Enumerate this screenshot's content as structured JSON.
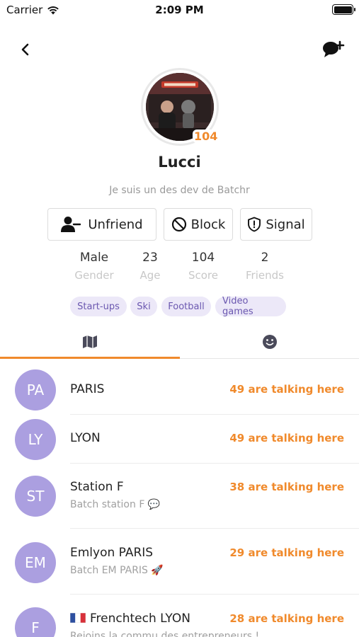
{
  "status_bar": {
    "carrier": "Carrier",
    "time": "2:09 PM"
  },
  "profile": {
    "name": "Lucci",
    "bio": "Je suis un des dev de Batchr",
    "score_badge": "104"
  },
  "actions": {
    "unfriend": "Unfriend",
    "block": "Block",
    "signal": "Signal"
  },
  "stats": [
    {
      "value": "Male",
      "label": "Gender"
    },
    {
      "value": "23",
      "label": "Age"
    },
    {
      "value": "104",
      "label": "Score"
    },
    {
      "value": "2",
      "label": "Friends"
    }
  ],
  "tags": [
    "Start-ups",
    "Ski",
    "Football",
    "Video games"
  ],
  "tabs": {
    "active": "map-icon",
    "icons": [
      "map-icon",
      "smiley-icon"
    ]
  },
  "rooms": [
    {
      "initials": "PA",
      "name": "PARIS",
      "count": "49 are talking here",
      "desc": ""
    },
    {
      "initials": "LY",
      "name": "LYON",
      "count": "49 are talking here",
      "desc": ""
    },
    {
      "initials": "ST",
      "name": "Station F",
      "count": "38 are talking here",
      "desc": "Batch station F 💬"
    },
    {
      "initials": "EM",
      "name": "Emlyon PARIS",
      "count": "29 are talking here",
      "desc": "Batch EM PARIS 🚀"
    },
    {
      "initials": "F",
      "name": "Frenchtech LYON",
      "count": "28 are talking here",
      "desc": "Rejoins la commu des entrepreneurs !"
    }
  ],
  "colors": {
    "accent": "#f08a2c",
    "room_avatar": "#ab9fe0",
    "tag_bg": "#ece8f8",
    "tag_text": "#6b58b0"
  }
}
